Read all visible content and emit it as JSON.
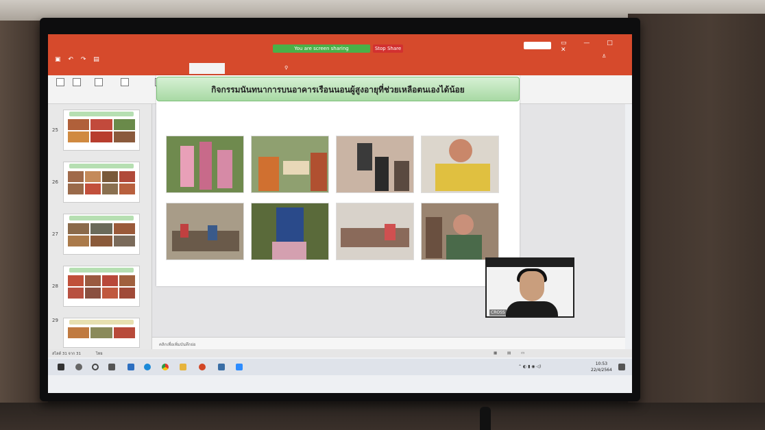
{
  "screen_share": {
    "banner_text": "You are screen sharing",
    "stop_label": "Stop Share"
  },
  "slide": {
    "title": "กิจกรรมนันทนาการบนอาคารเรือนนอนผู้สูงอายุที่ช่วยเหลือตนเองได้น้อย"
  },
  "thumbnails": [
    {
      "number": "25"
    },
    {
      "number": "26"
    },
    {
      "number": "27"
    },
    {
      "number": "28"
    },
    {
      "number": "29"
    }
  ],
  "notes": {
    "placeholder": "คลิกเพื่อเพิ่มบันทึกย่อ"
  },
  "status_bar": {
    "slide_count": "สไลด์ 31 จาก 31",
    "language": "ไทย"
  },
  "clock": {
    "time": "10:53",
    "date": "22/4/2564"
  },
  "video_call": {
    "name_tag": "CROSS"
  },
  "colors": {
    "title_bar": "#d64a2c",
    "share_banner": "#4ab048",
    "slide_title_band": "#a8d9a4"
  }
}
